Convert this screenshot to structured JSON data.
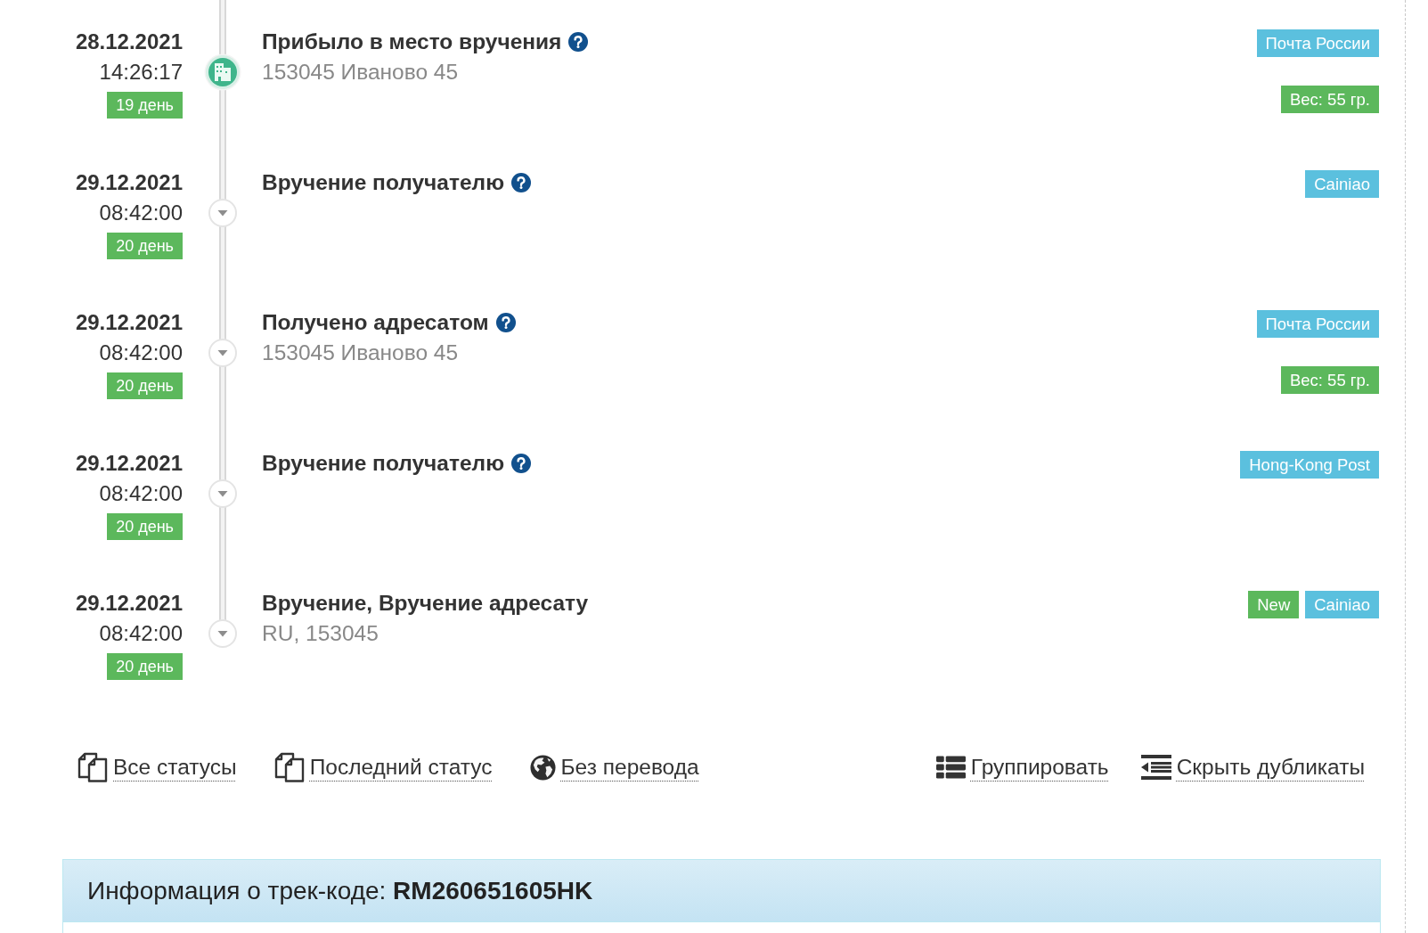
{
  "timeline": {
    "events": [
      {
        "date": "28.12.2021",
        "time": "14:26:17",
        "day": "19 день",
        "kind": "milestone",
        "title": "Прибыло в место вручения",
        "help": true,
        "address": "153045 Иваново 45",
        "tags": [
          {
            "text": "Почта России",
            "color": "#5bc0de"
          }
        ],
        "weight": "Вес: 55 гр."
      },
      {
        "date": "29.12.2021",
        "time": "08:42:00",
        "day": "20 день",
        "kind": "step",
        "title": "Вручение получателю",
        "help": true,
        "tags": [
          {
            "text": "Cainiao",
            "color": "#5bc0de"
          }
        ]
      },
      {
        "date": "29.12.2021",
        "time": "08:42:00",
        "day": "20 день",
        "kind": "step",
        "title": "Получено адресатом",
        "help": true,
        "address": "153045 Иваново 45",
        "tags": [
          {
            "text": "Почта России",
            "color": "#5bc0de"
          }
        ],
        "weight": "Вес: 55 гр."
      },
      {
        "date": "29.12.2021",
        "time": "08:42:00",
        "day": "20 день",
        "kind": "step",
        "title": "Вручение получателю",
        "help": true,
        "tags": [
          {
            "text": "Hong-Kong Post",
            "color": "#5bc0de"
          }
        ]
      },
      {
        "date": "29.12.2021",
        "time": "08:42:00",
        "day": "20 день",
        "kind": "step",
        "title": "Вручение, Вручение адресату",
        "help": false,
        "address": "RU, 153045",
        "tags": [
          {
            "text": "New",
            "color": "#5cb85c"
          },
          {
            "text": "Cainiao",
            "color": "#5bc0de"
          }
        ]
      }
    ]
  },
  "toolbar": {
    "left": [
      {
        "label": "Все статусы",
        "kind": "documents"
      },
      {
        "label": "Последний статус",
        "kind": "documents"
      },
      {
        "label": "Без перевода",
        "kind": "globe"
      }
    ],
    "right": [
      {
        "label": "Группировать",
        "kind": "list"
      },
      {
        "label": "Скрыть дубликаты",
        "kind": "outdent"
      }
    ]
  },
  "info_panel": {
    "title": "Информация о трек-коде: **RM260651605HK**"
  }
}
